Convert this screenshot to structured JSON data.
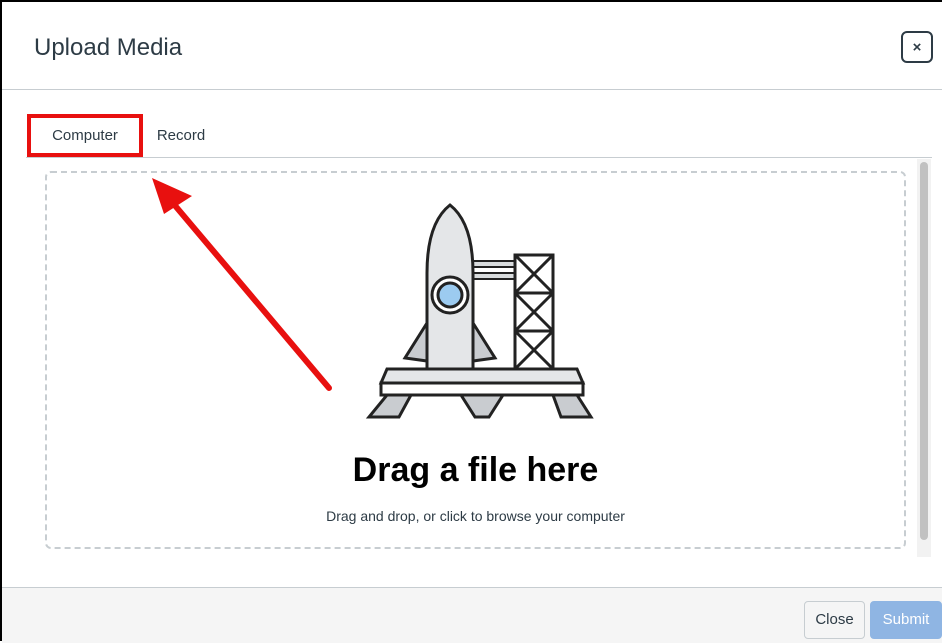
{
  "dialog": {
    "title": "Upload Media",
    "close_icon_label": "×"
  },
  "tabs": [
    {
      "label": "Computer",
      "selected": true
    },
    {
      "label": "Record",
      "selected": false
    }
  ],
  "dropzone": {
    "title": "Drag a file here",
    "subtitle": "Drag and drop, or click to browse your computer",
    "illustration": "rocket-launch-icon"
  },
  "footer": {
    "close_label": "Close",
    "submit_label": "Submit"
  },
  "annotation": {
    "highlight_color": "#e8100f",
    "arrow_color": "#e8100f"
  }
}
